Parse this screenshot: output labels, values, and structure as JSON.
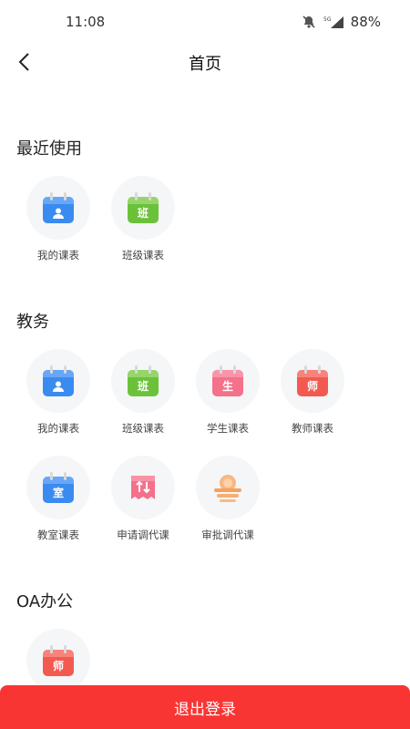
{
  "status_bar": {
    "time": "11:08",
    "network": "5G",
    "battery": "88%"
  },
  "nav": {
    "title": "首页"
  },
  "sections": {
    "recent": {
      "title": "最近使用",
      "items": [
        {
          "label": "我的课表",
          "icon": "person-calendar-icon",
          "glyph": "",
          "color": "#3a8bf0"
        },
        {
          "label": "班级课表",
          "icon": "class-calendar-icon",
          "glyph": "班",
          "color": "#6bc23a"
        }
      ]
    },
    "academic": {
      "title": "教务",
      "items": [
        {
          "label": "我的课表",
          "icon": "person-calendar-icon",
          "glyph": "",
          "color": "#3a8bf0"
        },
        {
          "label": "班级课表",
          "icon": "class-calendar-icon",
          "glyph": "班",
          "color": "#6bc23a"
        },
        {
          "label": "学生课表",
          "icon": "student-calendar-icon",
          "glyph": "生",
          "color": "#f5708a"
        },
        {
          "label": "教师课表",
          "icon": "teacher-calendar-icon",
          "glyph": "师",
          "color": "#f25a50"
        },
        {
          "label": "教室课表",
          "icon": "classroom-calendar-icon",
          "glyph": "室",
          "color": "#3a8bf0"
        },
        {
          "label": "申请调代课",
          "icon": "swap-request-icon",
          "glyph": "",
          "color": "#f5708a"
        },
        {
          "label": "审批调代课",
          "icon": "approval-scale-icon",
          "glyph": "",
          "color": "#f8a15a"
        }
      ]
    },
    "oa": {
      "title": "OA办公",
      "items": [
        {
          "label": "",
          "icon": "teacher-calendar-icon",
          "glyph": "师",
          "color": "#f25a50"
        }
      ]
    }
  },
  "logout": {
    "label": "退出登录"
  }
}
